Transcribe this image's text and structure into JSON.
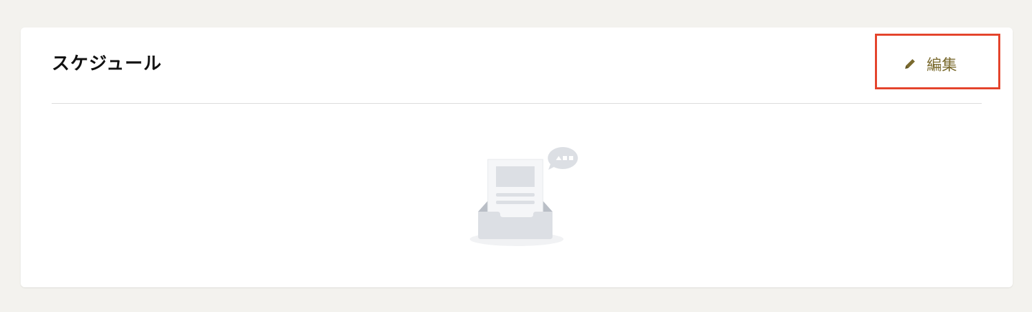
{
  "section": {
    "title": "スケジュール",
    "edit_label": "編集",
    "edit_icon": "pencil-icon",
    "empty_icon": "empty-inbox-icon"
  },
  "colors": {
    "page_background": "#f3f2ee",
    "card_background": "#ffffff",
    "accent": "#7a6a2e",
    "highlight": "#e4432b"
  }
}
